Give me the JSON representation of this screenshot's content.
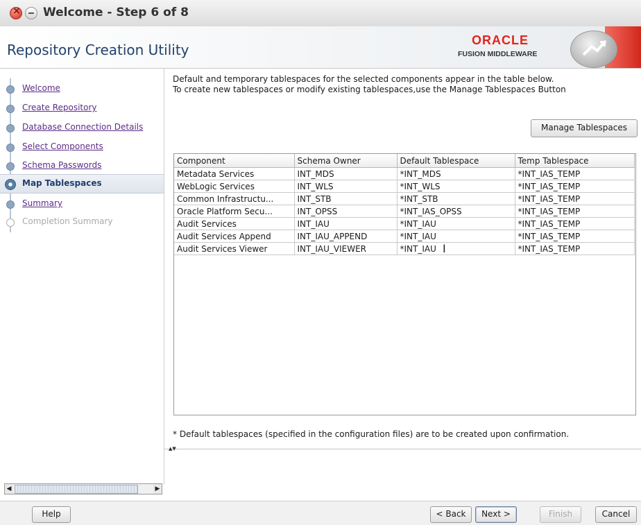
{
  "window": {
    "title": "Welcome - Step 6 of 8"
  },
  "header": {
    "app_title": "Repository Creation Utility",
    "logo_word": "ORACLE",
    "logo_sub": "FUSION MIDDLEWARE"
  },
  "nav": {
    "items": [
      {
        "label": "Welcome",
        "state": "done"
      },
      {
        "label": "Create Repository",
        "state": "done"
      },
      {
        "label": "Database Connection Details",
        "state": "done"
      },
      {
        "label": "Select Components",
        "state": "done"
      },
      {
        "label": "Schema Passwords",
        "state": "done"
      },
      {
        "label": "Map Tablespaces",
        "state": "current"
      },
      {
        "label": "Summary",
        "state": "next"
      },
      {
        "label": "Completion Summary",
        "state": "disabled"
      }
    ]
  },
  "content": {
    "line1": "Default and temporary tablespaces for the selected components appear in the table below.",
    "line2": "To create new tablespaces or modify existing tablespaces,use the Manage Tablespaces Button",
    "manage_button": "Manage Tablespaces",
    "footnote": "* Default tablespaces (specified in the configuration files) are to be created upon confirmation."
  },
  "table": {
    "columns": [
      "Component",
      "Schema Owner",
      "Default Tablespace",
      "Temp Tablespace"
    ],
    "rows": [
      [
        "Metadata Services",
        "INT_MDS",
        "*INT_MDS",
        "*INT_IAS_TEMP"
      ],
      [
        "WebLogic Services",
        "INT_WLS",
        "*INT_WLS",
        "*INT_IAS_TEMP"
      ],
      [
        "Common Infrastructu...",
        "INT_STB",
        "*INT_STB",
        "*INT_IAS_TEMP"
      ],
      [
        "Oracle Platform Secu...",
        "INT_OPSS",
        "*INT_IAS_OPSS",
        "*INT_IAS_TEMP"
      ],
      [
        "Audit Services",
        "INT_IAU",
        "*INT_IAU",
        "*INT_IAS_TEMP"
      ],
      [
        "Audit Services Append",
        "INT_IAU_APPEND",
        "*INT_IAU",
        "*INT_IAS_TEMP"
      ],
      [
        "Audit Services Viewer",
        "INT_IAU_VIEWER",
        "*INT_IAU",
        "*INT_IAS_TEMP"
      ]
    ]
  },
  "buttons": {
    "help": "Help",
    "back": "< Back",
    "next": "Next >",
    "finish": "Finish",
    "cancel": "Cancel"
  }
}
